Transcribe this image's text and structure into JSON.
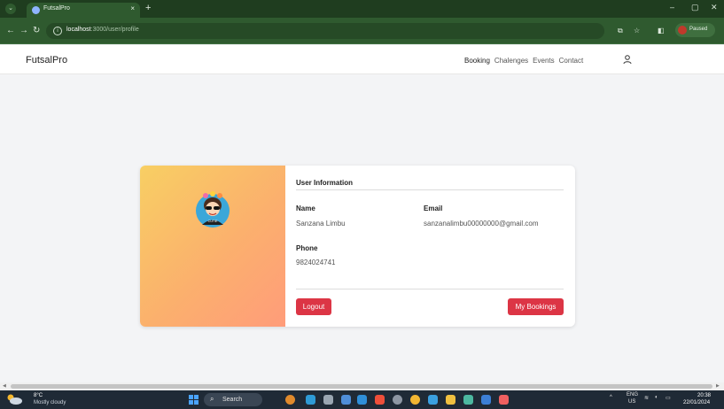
{
  "browser": {
    "tab_title": "FutsalPro",
    "tab_close": "×",
    "new_tab": "+",
    "url_host": "localhost",
    "url_path": ":3000/user/profile",
    "profile_label": "Paused",
    "win_minimize": "–",
    "win_restore": "▢",
    "win_close": "✕"
  },
  "site": {
    "brand": "FutsalPro",
    "nav": [
      "Booking",
      "Chalenges",
      "Events",
      "Contact"
    ]
  },
  "profile": {
    "section_title": "User Information",
    "name_label": "Name",
    "name_value": "Sanzana Limbu",
    "email_label": "Email",
    "email_value": "sanzanalimbu00000000@gmail.com",
    "phone_label": "Phone",
    "phone_value": "9824024741",
    "logout_label": "Logout",
    "bookings_label": "My Bookings",
    "avatar_caption": "CUTIE"
  },
  "taskbar": {
    "weather_temp": "8°C",
    "weather_desc": "Mostly cloudy",
    "search_label": "Search",
    "lang_top": "ENG",
    "lang_bottom": "US",
    "time": "20:38",
    "date": "22/01/2024"
  },
  "colors": {
    "browser_frame": "#2f5a2f",
    "accent_red": "#dc3545",
    "page_bg": "#f3f4f6"
  },
  "icons": [
    "chevron-down-icon",
    "back-arrow-icon",
    "forward-arrow-icon",
    "reload-icon",
    "info-icon",
    "cast-icon",
    "star-icon",
    "sidepanel-icon",
    "user-icon",
    "weather-icon",
    "windows-icon",
    "search-icon"
  ]
}
